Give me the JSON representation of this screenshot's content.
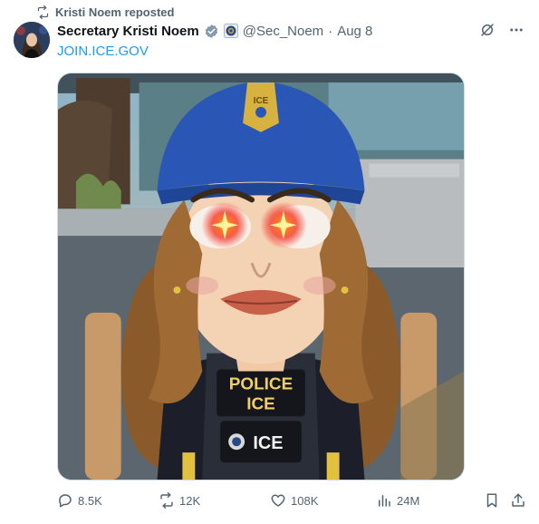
{
  "repost": {
    "label": "Kristi Noem reposted"
  },
  "post": {
    "author_name": "Secretary Kristi Noem",
    "handle": "@Sec_Noem",
    "separator": "·",
    "date": "Aug 8",
    "link_text": "JOIN.ICE.GOV",
    "image": {
      "vest_text_line1": "POLICE",
      "vest_text_line2": "ICE",
      "patch_text": "ICE",
      "cap_badge_text": "ICE"
    }
  },
  "actions": {
    "replies": "8.5K",
    "reposts": "12K",
    "likes": "108K",
    "views": "24M"
  },
  "colors": {
    "link": "#1d9bf0",
    "secondary_text": "#536471",
    "verified": "#829aab"
  },
  "icons": [
    "repost-icon",
    "verified-badge-icon",
    "agency-seal-icon",
    "grok-icon",
    "more-icon",
    "reply-icon",
    "like-icon",
    "views-icon",
    "bookmark-icon",
    "share-icon"
  ]
}
